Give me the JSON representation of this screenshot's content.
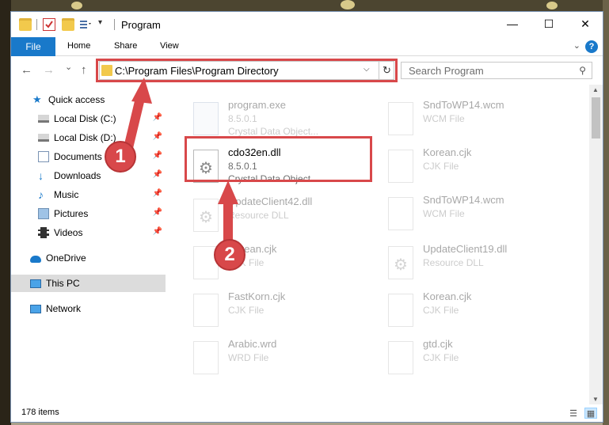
{
  "window": {
    "title": "Program"
  },
  "window_controls": {
    "minimize": "—",
    "maximize": "☐",
    "close": "✕"
  },
  "ribbon": {
    "tabs": [
      "File",
      "Home",
      "Share",
      "View"
    ],
    "help": "?"
  },
  "navigation": {
    "back": "←",
    "forward": "→",
    "recent": "⌄",
    "up": "↑",
    "address": "C:\\Program Files\\Program Directory",
    "search_placeholder": "Search Program"
  },
  "sidebar": {
    "items": [
      {
        "label": "Quick access",
        "icon": "star-icon",
        "pinned": false
      },
      {
        "label": "Local Disk (C:)",
        "icon": "drive-icon",
        "pinned": true
      },
      {
        "label": "Local Disk (D:)",
        "icon": "drive-icon",
        "pinned": true
      },
      {
        "label": "Documents",
        "icon": "documents-icon",
        "pinned": true
      },
      {
        "label": "Downloads",
        "icon": "download-icon",
        "pinned": true
      },
      {
        "label": "Music",
        "icon": "music-icon",
        "pinned": true
      },
      {
        "label": "Pictures",
        "icon": "pictures-icon",
        "pinned": true
      },
      {
        "label": "Videos",
        "icon": "videos-icon",
        "pinned": true
      },
      {
        "label": "OneDrive",
        "icon": "cloud-icon",
        "pinned": false
      },
      {
        "label": "This PC",
        "icon": "pc-icon",
        "pinned": false,
        "selected": true
      },
      {
        "label": "Network",
        "icon": "network-icon",
        "pinned": false
      }
    ]
  },
  "files": {
    "left": [
      {
        "name": "program.exe",
        "line2": "8.5.0.1",
        "line3": "Crystal Data Object..."
      },
      {
        "name": "cdo32en.dll",
        "line2": "8.5.0.1",
        "line3": "Crystal Data Object..."
      },
      {
        "name": "UpdateClient42.dll",
        "line2": "Resource DLL",
        "line3": ""
      },
      {
        "name": "Korean.cjk",
        "line2": "CJK File",
        "line3": ""
      },
      {
        "name": "FastKorn.cjk",
        "line2": "CJK File",
        "line3": ""
      },
      {
        "name": "Arabic.wrd",
        "line2": "WRD File",
        "line3": ""
      }
    ],
    "right": [
      {
        "name": "SndToWP14.wcm",
        "line2": "WCM File"
      },
      {
        "name": "Korean.cjk",
        "line2": "CJK File"
      },
      {
        "name": "SndToWP14.wcm",
        "line2": "WCM File"
      },
      {
        "name": "UpdateClient19.dll",
        "line2": "Resource DLL"
      },
      {
        "name": "Korean.cjk",
        "line2": "CJK File"
      },
      {
        "name": "gtd.cjk",
        "line2": "CJK File"
      }
    ]
  },
  "status": {
    "item_count": "178 items"
  },
  "callouts": {
    "one": "1",
    "two": "2"
  },
  "colors": {
    "accent": "#1979ca",
    "highlight": "#d8484a"
  }
}
